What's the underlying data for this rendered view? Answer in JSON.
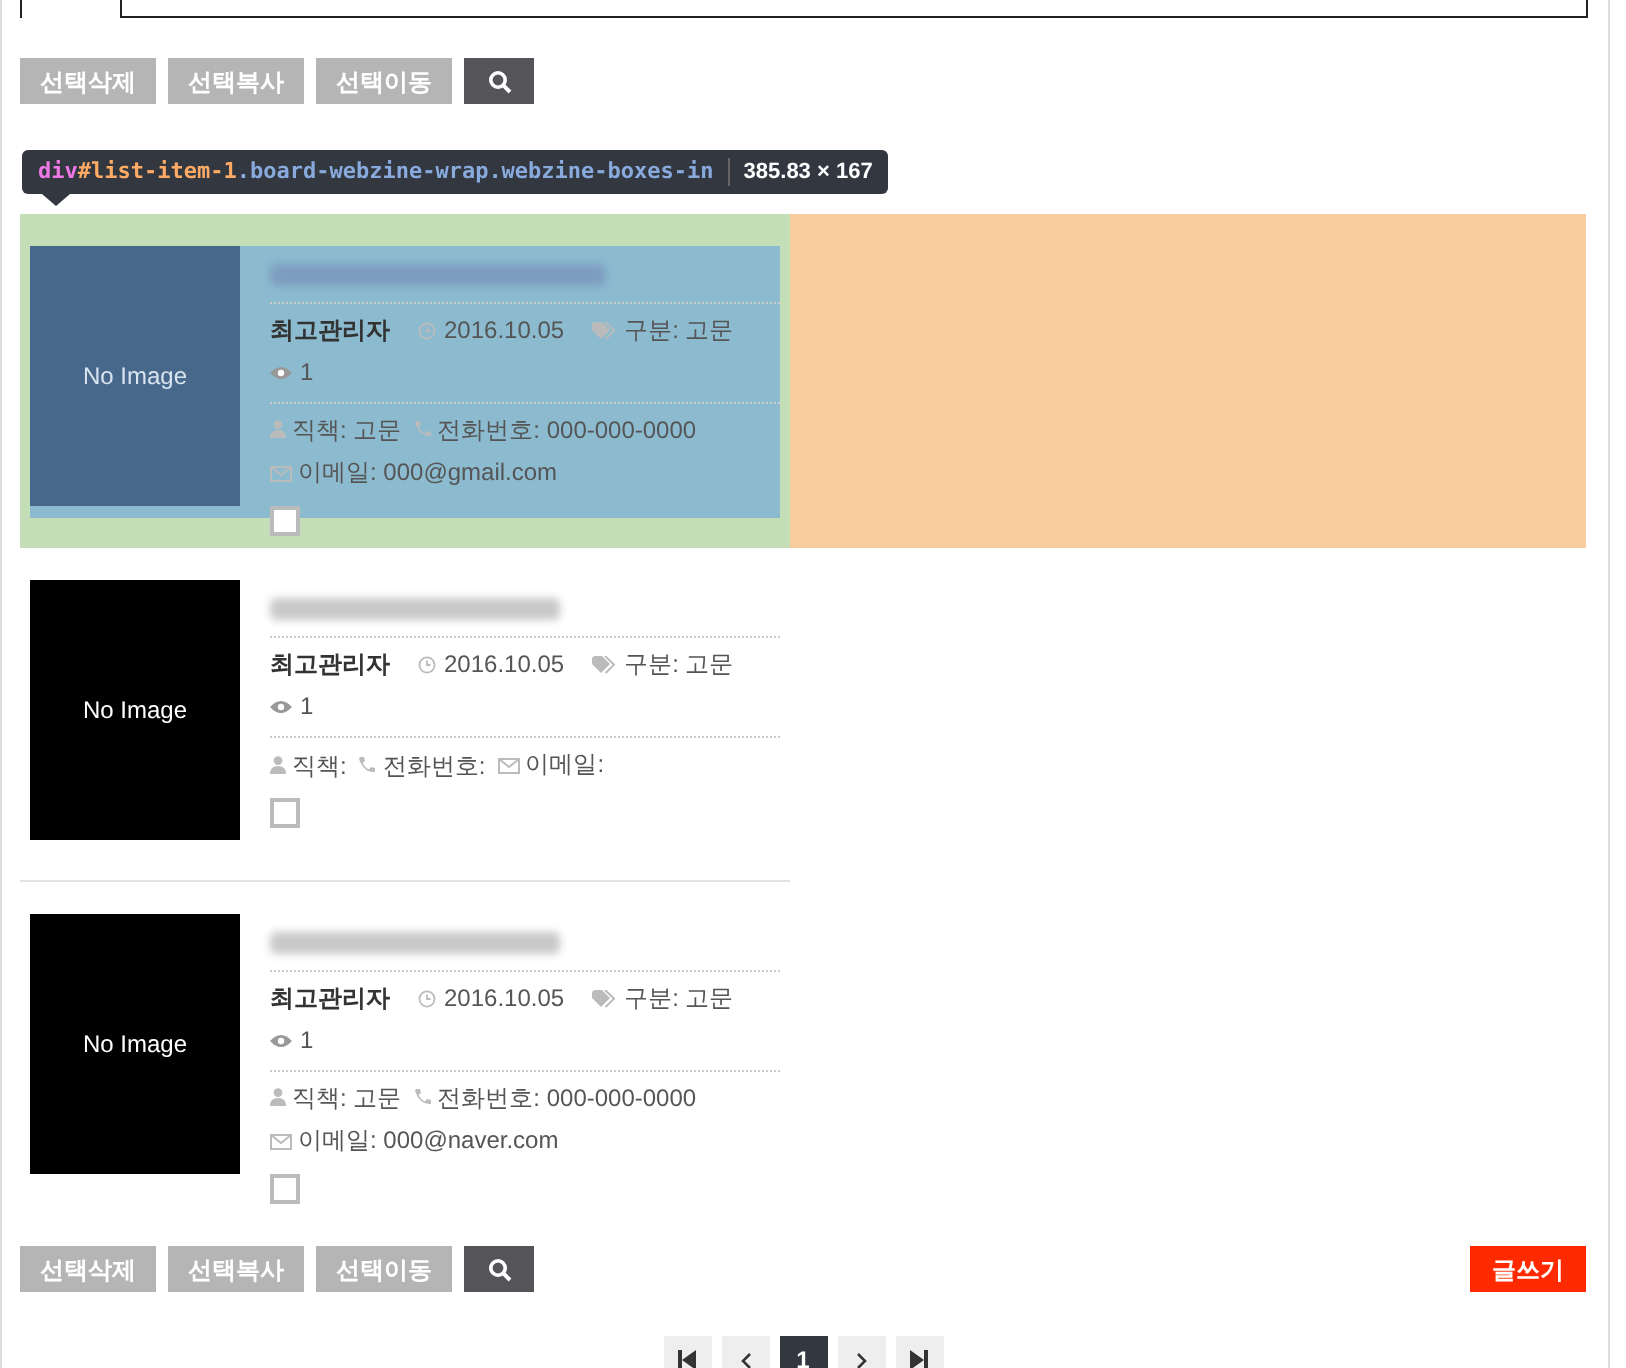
{
  "top_actions": [
    {
      "kind": "text",
      "label": "선택삭제"
    },
    {
      "kind": "text",
      "label": "선택복사"
    },
    {
      "kind": "text",
      "label": "선택이동"
    },
    {
      "kind": "search"
    }
  ],
  "inspector_tooltip": {
    "tag": "div",
    "id": "#list-item-1",
    "classes": ".board-webzine-wrap.webzine-boxes-in",
    "size": "385.83 × 167"
  },
  "posts": [
    {
      "highlighted": true,
      "thumbnail": "No Image",
      "author": "최고관리자",
      "date": "2016.10.05",
      "category": "구분: 고문",
      "views": "1",
      "position": "직책: 고문",
      "phone": "전화번호: 000-000-0000",
      "email": "이메일: 000@gmail.com",
      "checked": false
    },
    {
      "highlighted": false,
      "thumbnail": "No Image",
      "author": "최고관리자",
      "date": "2016.10.05",
      "category": "구분: 고문",
      "views": "1",
      "position": "직책:",
      "phone": "전화번호:",
      "email": "이메일:",
      "checked": false
    },
    {
      "highlighted": false,
      "thumbnail": "No Image",
      "author": "최고관리자",
      "date": "2016.10.05",
      "category": "구분: 고문",
      "views": "1",
      "position": "직책: 고문",
      "phone": "전화번호: 000-000-0000",
      "email": "이메일: 000@naver.com",
      "checked": false
    }
  ],
  "bottom_actions": [
    {
      "kind": "text",
      "label": "선택삭제"
    },
    {
      "kind": "text",
      "label": "선택복사"
    },
    {
      "kind": "text",
      "label": "선택이동"
    },
    {
      "kind": "search"
    }
  ],
  "write_button": "글쓰기",
  "pagination": [
    {
      "kind": "first"
    },
    {
      "kind": "prev"
    },
    {
      "kind": "page",
      "label": "1",
      "selected": true
    },
    {
      "kind": "next"
    },
    {
      "kind": "last"
    }
  ]
}
